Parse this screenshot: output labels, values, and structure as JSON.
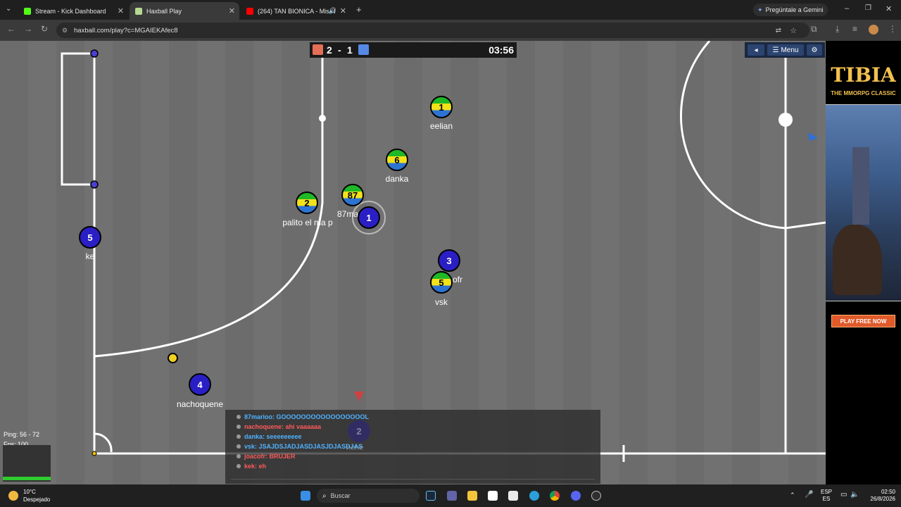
{
  "browser": {
    "tabs": [
      {
        "title": "Stream - Kick Dashboard",
        "color": "#53fc18"
      },
      {
        "title": "Haxball Play",
        "color": "#b6d98f"
      },
      {
        "title": "(264) TAN BIONICA - Mis N",
        "color": "#ff0000"
      }
    ],
    "gemini_label": "Pregúntale a Gemini",
    "url": "haxball.com/play?c=MGAIEKAfec8"
  },
  "scoreboard": {
    "red_score": "2",
    "separator": "-",
    "blue_score": "1",
    "time": "03:56",
    "red_color": "#e56e56",
    "blue_color": "#5689e5"
  },
  "menu": {
    "label": "Menu"
  },
  "players": [
    {
      "number": "1",
      "name": "eelian",
      "team": "flag"
    },
    {
      "number": "6",
      "name": "danka",
      "team": "flag"
    },
    {
      "number": "87",
      "name": "87ma",
      "team": "flag"
    },
    {
      "number": "2",
      "name": "palito el ma p",
      "team": "flag"
    },
    {
      "number": "1",
      "name": "",
      "team": "blue"
    },
    {
      "number": "5",
      "name": "ke",
      "team": "blue"
    },
    {
      "number": "3",
      "name": "ofr",
      "team": "blue"
    },
    {
      "number": "5",
      "name": "vsk",
      "team": "flag"
    },
    {
      "number": "4",
      "name": "nachoquene",
      "team": "blue"
    }
  ],
  "chat": [
    {
      "text": "87marioo: GOOOOOOOOOOOOOOOOOL",
      "color": "#4fb2ff"
    },
    {
      "text": "nachoquene: ahi vaaaaaa",
      "color": "#ff5a5a"
    },
    {
      "text": "danka: seeeeeeeee",
      "color": "#4fb2ff"
    },
    {
      "text": "vsk: JSAJDSJADJASDJASJDJASDJAS",
      "color": "#4fb2ff"
    },
    {
      "text": "joacofr: BRUJER",
      "color": "#ff5a5a"
    },
    {
      "text": "kek: eh",
      "color": "#ff5a5a"
    }
  ],
  "ghost_player": {
    "number": "2",
    "name": "none"
  },
  "stats": {
    "ping": "Ping: 56 - 72",
    "fps": "Fps: 100"
  },
  "ad": {
    "title": "TIBIA",
    "subtitle": "THE MMORPG CLASSIC",
    "cta": "PLAY FREE NOW"
  },
  "taskbar": {
    "weather_temp": "10°C",
    "weather_desc": "Despejado",
    "search_placeholder": "Buscar",
    "lang1": "ESP",
    "lang2": "ES",
    "time": "02:50",
    "date": "26/8/2026"
  }
}
